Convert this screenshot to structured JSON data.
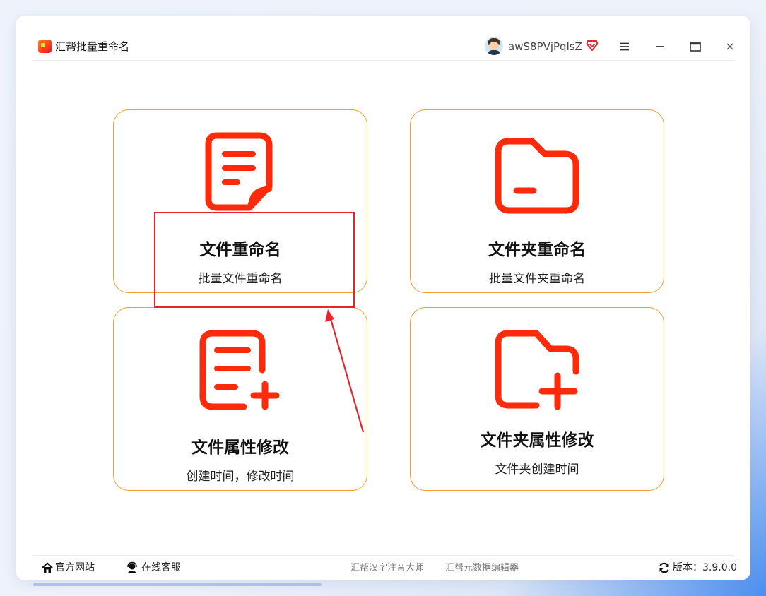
{
  "app": {
    "title": "汇帮批量重命名",
    "username": "awS8PVjPqlsZ"
  },
  "cards": [
    {
      "title": "文件重命名",
      "subtitle": "批量文件重命名",
      "icon": "file-document-icon"
    },
    {
      "title": "文件夹重命名",
      "subtitle": "批量文件夹重命名",
      "icon": "folder-icon"
    },
    {
      "title": "文件属性修改",
      "subtitle": "创建时间，修改时间",
      "icon": "file-add-icon"
    },
    {
      "title": "文件夹属性修改",
      "subtitle": "文件夹创建时间",
      "icon": "folder-add-icon"
    }
  ],
  "footer": {
    "website": "官方网站",
    "support": "在线客服",
    "link1": "汇帮汉字注音大师",
    "link2": "汇帮元数据编辑器",
    "version_label": "版本：",
    "version": "3.9.0.0"
  },
  "colors": {
    "accent": "#ff2a0a",
    "card_border": "#f0a030",
    "annotation": "#e8232b"
  }
}
